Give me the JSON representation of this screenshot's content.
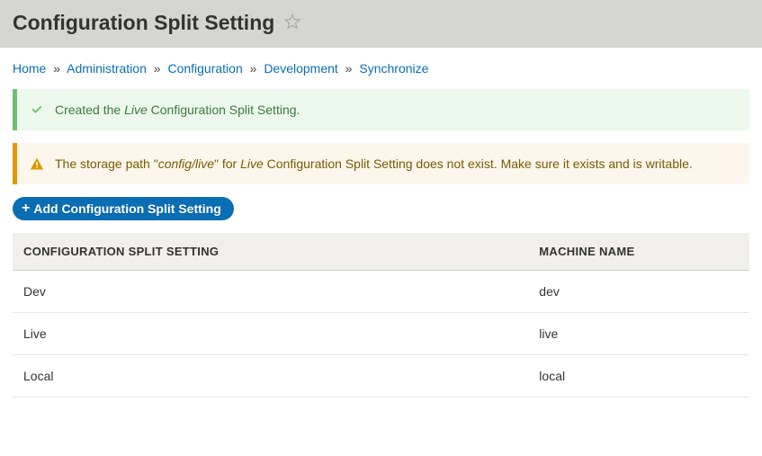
{
  "header": {
    "title": "Configuration Split Setting"
  },
  "breadcrumb": {
    "items": [
      {
        "label": "Home"
      },
      {
        "label": "Administration"
      },
      {
        "label": "Configuration"
      },
      {
        "label": "Development"
      },
      {
        "label": "Synchronize"
      }
    ],
    "sep": "»"
  },
  "messages": {
    "success": {
      "prefix": "Created the ",
      "em": "Live",
      "suffix": " Configuration Split Setting."
    },
    "warning": {
      "prefix": "The storage path \"",
      "path_em": "config/live",
      "mid1": "\" for ",
      "name_em": "Live",
      "suffix": " Configuration Split Setting does not exist. Make sure it exists and is writable."
    }
  },
  "actions": {
    "add_label": "Add Configuration Split Setting"
  },
  "table": {
    "columns": {
      "name": "Configuration Split Setting",
      "machine": "Machine name"
    },
    "rows": [
      {
        "name": "Dev",
        "machine": "dev"
      },
      {
        "name": "Live",
        "machine": "live"
      },
      {
        "name": "Local",
        "machine": "local"
      }
    ]
  }
}
